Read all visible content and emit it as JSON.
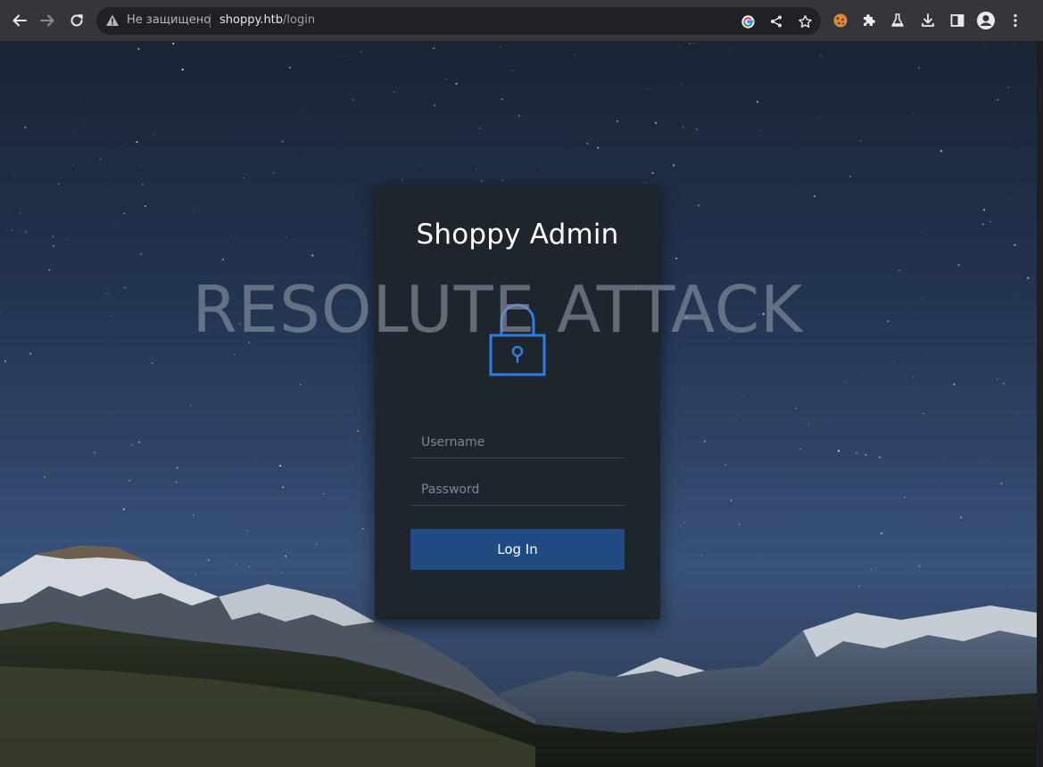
{
  "browser": {
    "security_label": "Не защищено",
    "url_host": "shoppy.htb",
    "url_path": "/login",
    "nav": {
      "back": "arrow-left-icon",
      "forward": "arrow-right-icon",
      "reload": "reload-icon"
    },
    "toolbar_icons": [
      "google-icon",
      "share-icon",
      "star-icon",
      "cookie-icon",
      "extensions-puzzle-icon",
      "labs-flask-icon",
      "download-icon",
      "side-panel-icon",
      "profile-icon",
      "menu-dots-icon"
    ]
  },
  "page": {
    "watermark": "RESOLUTE ATTACK",
    "login": {
      "title": "Shoppy Admin",
      "username_placeholder": "Username",
      "username_value": "",
      "password_placeholder": "Password",
      "password_value": "",
      "submit_label": "Log In"
    }
  },
  "colors": {
    "accent_blue": "#2f7de1",
    "button_blue": "#1f4a82",
    "card_bg": "#1e252d"
  }
}
